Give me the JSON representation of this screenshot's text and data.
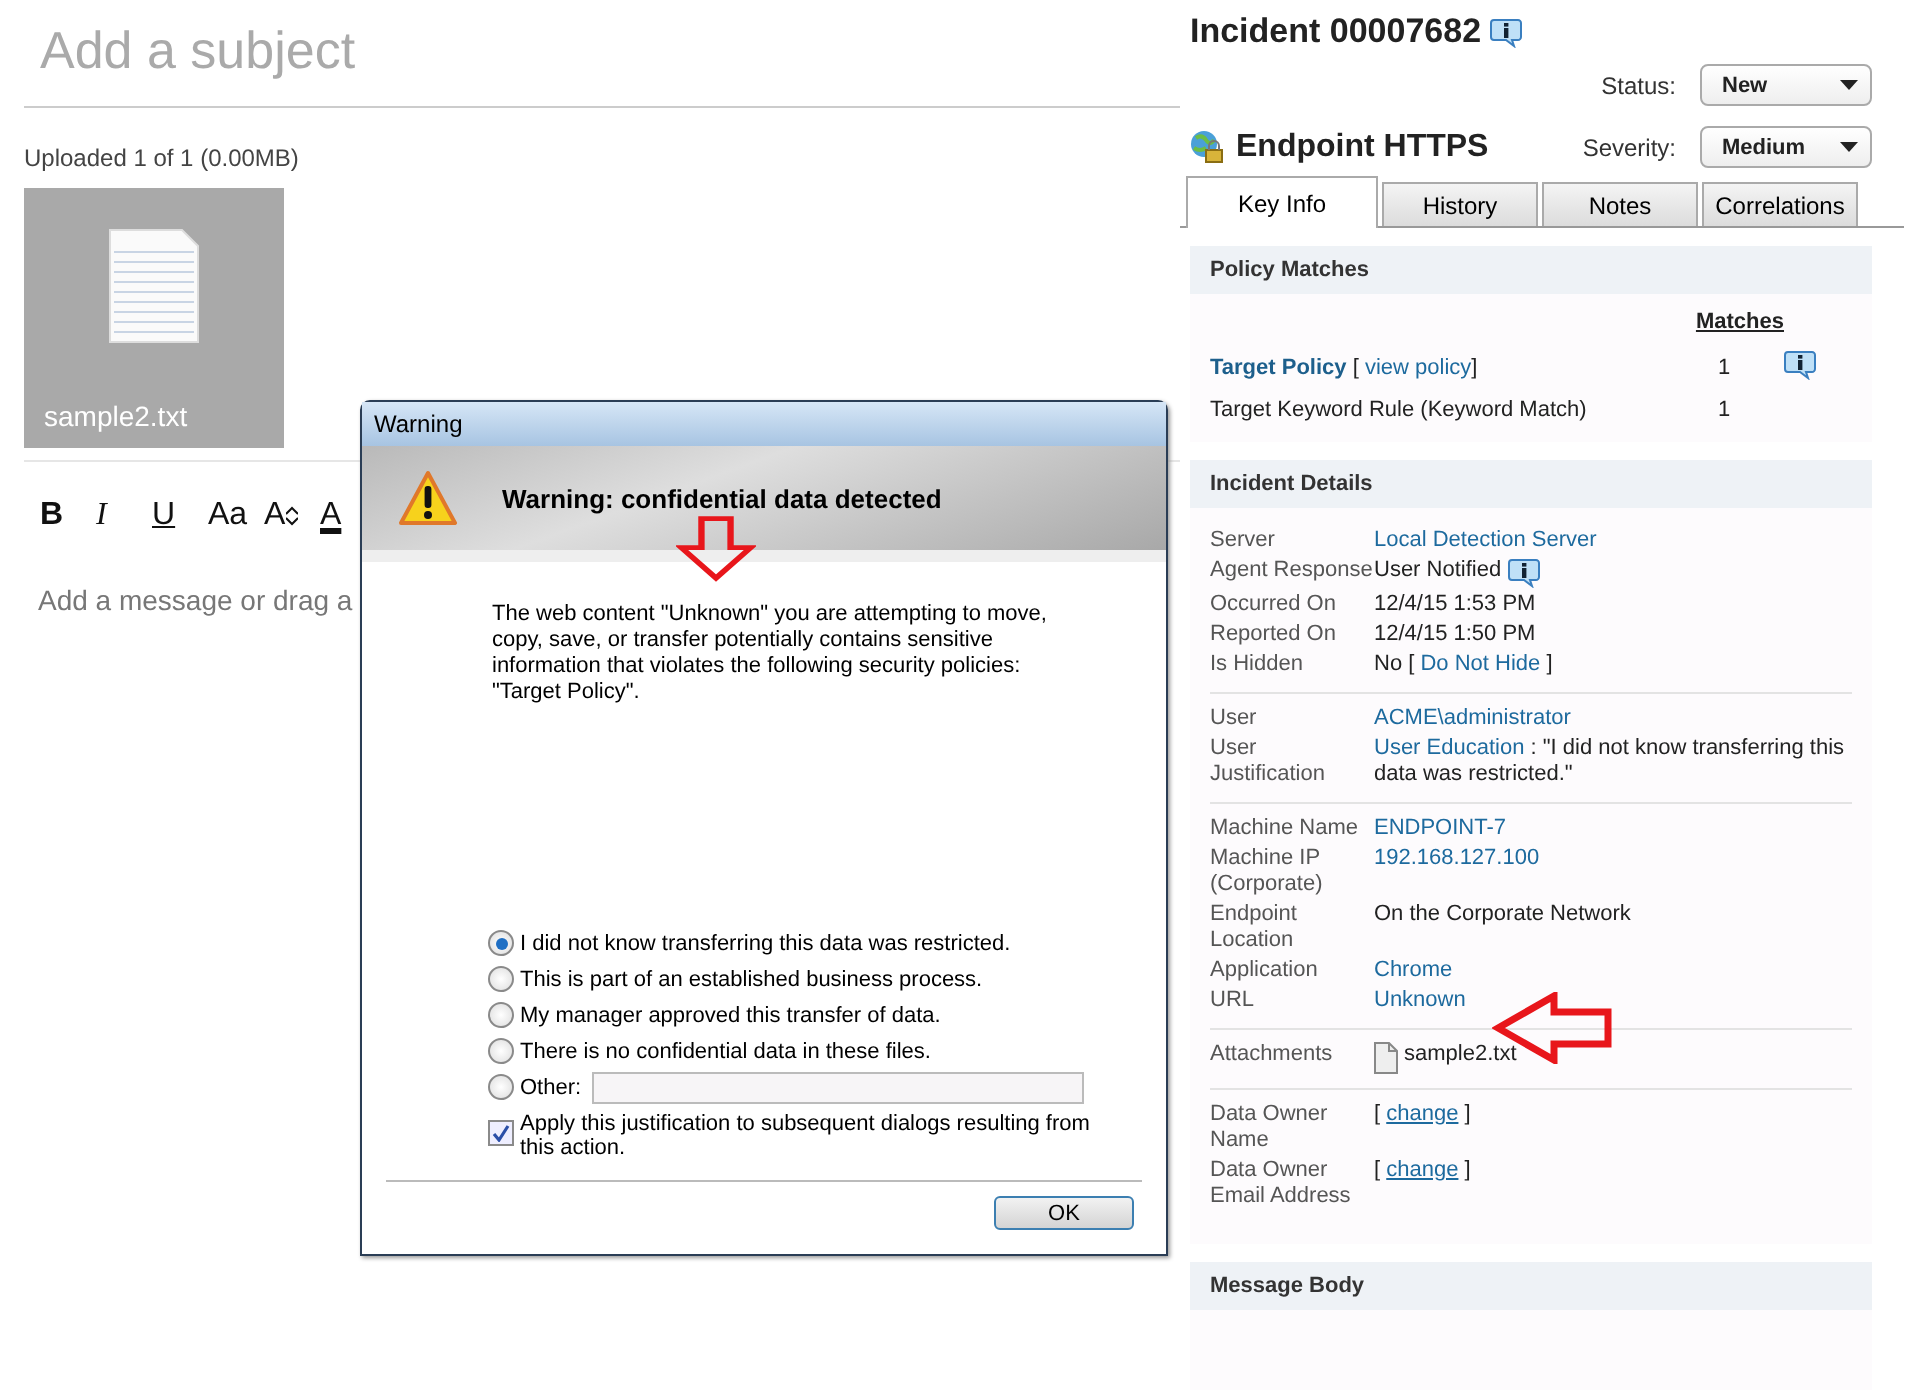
{
  "composer": {
    "subject_placeholder": "Add a subject",
    "upload_status": "Uploaded 1 of 1 (0.00MB)",
    "attachment": {
      "name": "sample2.txt"
    },
    "toolbar": [
      {
        "kind": "bold",
        "label": "B"
      },
      {
        "kind": "italic",
        "label": "I"
      },
      {
        "kind": "underline",
        "label": "U"
      },
      {
        "kind": "font",
        "label": "Aa"
      },
      {
        "kind": "size",
        "label": "A"
      },
      {
        "kind": "color",
        "label": "A"
      }
    ],
    "message_placeholder": "Add a message or drag a"
  },
  "dialog": {
    "title": "Warning",
    "heading": "Warning: confidential data detected",
    "message": "The web content \"Unknown\" you are attempting to move, copy, save, or transfer potentially contains sensitive information that violates the following security policies: \"Target Policy\".",
    "options": [
      {
        "label": "I did not know transferring this data was restricted.",
        "selected": true
      },
      {
        "label": "This is part of an established business process.",
        "selected": false
      },
      {
        "label": "My manager approved this transfer of data.",
        "selected": false
      },
      {
        "label": "There is no confidential data in these files.",
        "selected": false
      },
      {
        "label": "Other:",
        "selected": false,
        "kind": "other"
      }
    ],
    "apply": {
      "label": "Apply this justification to subsequent dialogs resulting from this action.",
      "checked": true
    },
    "buttons": [
      "OK"
    ]
  },
  "incident": {
    "title": "Incident 00007682",
    "status": {
      "label": "Status:",
      "value": "New"
    },
    "severity": {
      "label": "Severity:",
      "value": "Medium"
    },
    "channel": "Endpoint HTTPS",
    "tabs": [
      {
        "label": "Key Info",
        "selected": true
      },
      {
        "label": "History",
        "selected": false
      },
      {
        "label": "Notes",
        "selected": false
      },
      {
        "label": "Correlations",
        "selected": false
      }
    ],
    "policy_matches": {
      "title": "Policy Matches",
      "column": "Matches",
      "rows": [
        {
          "kind": "policy",
          "name": "Target Policy",
          "prefix": "[ ",
          "link": "view policy",
          "suffix": "]",
          "count": "1"
        },
        {
          "kind": "rule",
          "name": "Target Keyword Rule (Keyword Match)",
          "count": "1"
        }
      ]
    },
    "details": {
      "title": "Incident Details",
      "groups": [
        {
          "rows": [
            {
              "label": "Server",
              "parts": [
                {
                  "text": "Local Detection Server",
                  "kind": "link"
                }
              ]
            },
            {
              "label": "Agent Response",
              "parts": [
                {
                  "text": "User Notified",
                  "kind": "text"
                }
              ],
              "info": true
            },
            {
              "label": "Occurred On",
              "parts": [
                {
                  "text": "12/4/15 1:53 PM",
                  "kind": "text"
                }
              ]
            },
            {
              "label": "Reported On",
              "parts": [
                {
                  "text": "12/4/15 1:50 PM",
                  "kind": "text"
                }
              ]
            },
            {
              "label": "Is Hidden",
              "parts": [
                {
                  "text": "No [ ",
                  "kind": "text"
                },
                {
                  "text": "Do Not Hide",
                  "kind": "link"
                },
                {
                  "text": " ]",
                  "kind": "text"
                }
              ]
            }
          ]
        },
        {
          "rows": [
            {
              "label": "User",
              "parts": [
                {
                  "text": "ACME\\administrator",
                  "kind": "link"
                }
              ]
            },
            {
              "label": "User Justification",
              "parts": [
                {
                  "text": "User Education",
                  "kind": "link"
                },
                {
                  "text": " : \"I did not know transferring this data was restricted.\"",
                  "kind": "text"
                }
              ]
            }
          ]
        },
        {
          "rows": [
            {
              "label": "Machine Name",
              "parts": [
                {
                  "text": "ENDPOINT-7",
                  "kind": "link"
                }
              ]
            },
            {
              "label": "Machine IP (Corporate)",
              "parts": [
                {
                  "text": "192.168.127.100",
                  "kind": "link"
                }
              ]
            },
            {
              "label": "Endpoint Location",
              "parts": [
                {
                  "text": "On the Corporate Network",
                  "kind": "text"
                }
              ]
            },
            {
              "label": "Application",
              "parts": [
                {
                  "text": "Chrome",
                  "kind": "link"
                }
              ]
            },
            {
              "label": "URL",
              "parts": [
                {
                  "text": "Unknown",
                  "kind": "link"
                }
              ]
            }
          ]
        },
        {
          "rows": [
            {
              "label": "Attachments",
              "parts": [
                {
                  "text": "sample2.txt",
                  "kind": "text"
                }
              ],
              "file": true
            }
          ]
        },
        {
          "rows": [
            {
              "label": "Data Owner Name",
              "parts": [
                {
                  "text": "[ ",
                  "kind": "text"
                },
                {
                  "text": "change",
                  "kind": "underlined-link"
                },
                {
                  "text": " ]",
                  "kind": "text"
                }
              ]
            },
            {
              "label": "Data Owner Email Address",
              "parts": [
                {
                  "text": "[ ",
                  "kind": "text"
                },
                {
                  "text": "change",
                  "kind": "underlined-link"
                },
                {
                  "text": " ]",
                  "kind": "text"
                }
              ]
            }
          ]
        }
      ]
    },
    "message_body": {
      "title": "Message Body"
    }
  }
}
